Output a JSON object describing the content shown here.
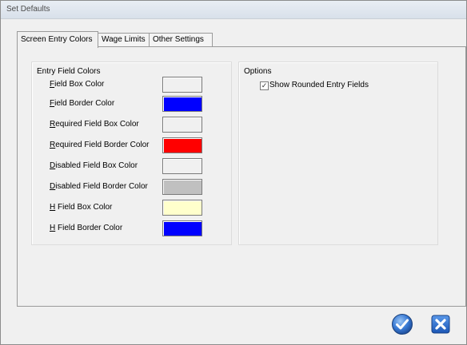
{
  "window": {
    "title": "Set Defaults"
  },
  "tabs": [
    {
      "label": "Screen Entry Colors",
      "active": true
    },
    {
      "label": "Wage Limits",
      "active": false
    },
    {
      "label": "Other Settings",
      "active": false
    }
  ],
  "entry_field_colors": {
    "title": "Entry Field Colors",
    "fields": [
      {
        "accel": "F",
        "rest": "ield Box Color",
        "color": "#f0f0f0"
      },
      {
        "accel": "F",
        "rest": "ield Border Color",
        "color": "#0000ff"
      },
      {
        "accel": "R",
        "rest": "equired Field Box Color",
        "color": "#f0f0f0"
      },
      {
        "accel": "R",
        "rest": "equired Field Border Color",
        "color": "#ff0000"
      },
      {
        "accel": "D",
        "rest": "isabled Field Box Color",
        "color": "#f0f0f0"
      },
      {
        "accel": "D",
        "rest": "isabled Field Border Color",
        "color": "#c0c0c0"
      },
      {
        "accel": "H",
        "rest": " Field Box Color",
        "color": "#ffffcc"
      },
      {
        "accel": "H",
        "rest": " Field Border Color",
        "color": "#0000ff"
      }
    ]
  },
  "options": {
    "title": "Options",
    "show_rounded_label": "Show Rounded Entry Fields",
    "show_rounded_checked": true
  },
  "buttons": {
    "ok_icon": "checkmark-icon",
    "cancel_icon": "close-x-icon",
    "ok_color": "#3a7bd5",
    "cancel_color": "#2a6fd6"
  }
}
